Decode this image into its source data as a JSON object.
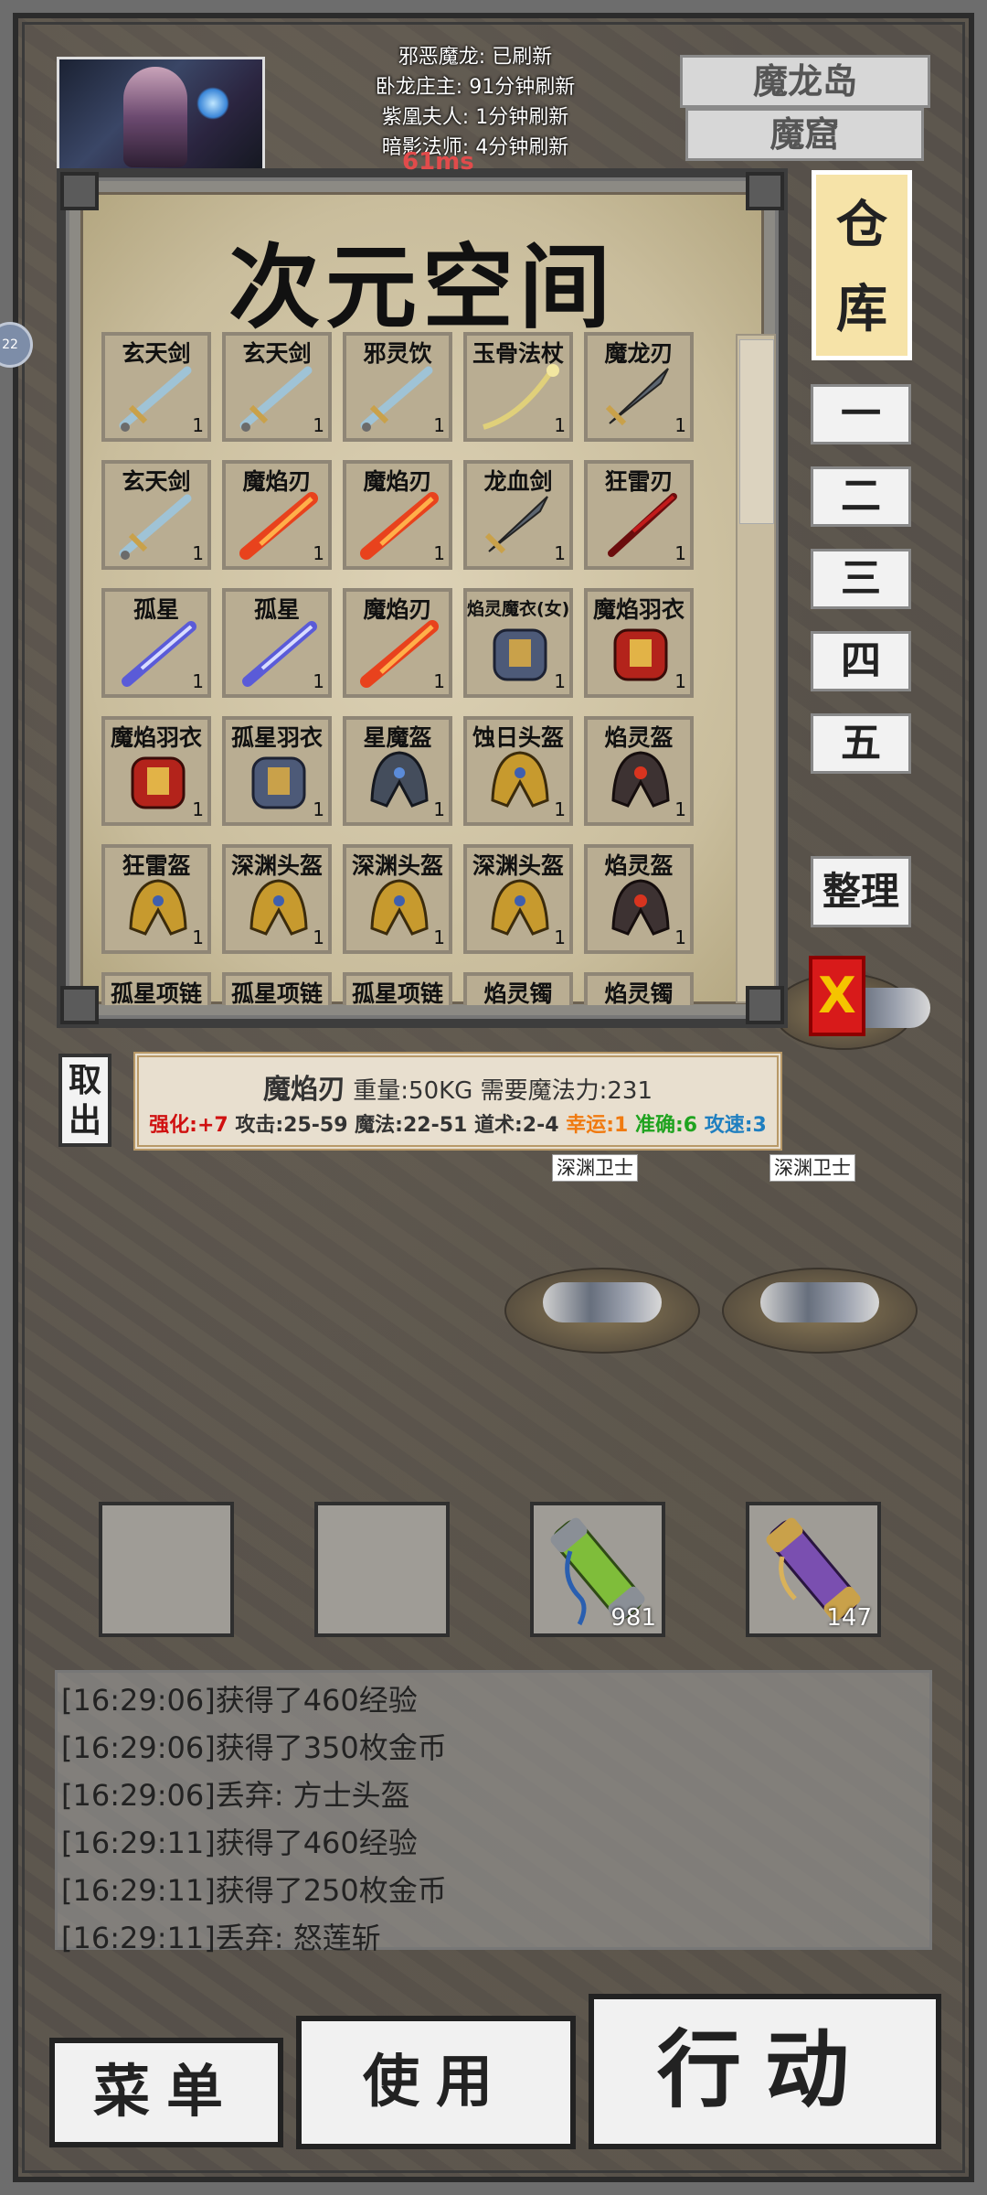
{
  "hud": {
    "boss_lines": [
      "邪恶魔龙: 已刷新",
      "卧龙庄主: 91分钟刷新",
      "紫凰夫人: 1分钟刷新",
      "暗影法师: 4分钟刷新"
    ],
    "ping": "61ms",
    "location_main": "魔龙岛",
    "location_sub": "魔窟",
    "side_indicator": "22"
  },
  "warehouse": {
    "title": "次元空间",
    "tab_label": "仓库",
    "pages": [
      "一",
      "二",
      "三",
      "四",
      "五"
    ],
    "sort_label": "整理",
    "close_label": "X",
    "take_label": "取出",
    "items": [
      {
        "name": "玄天剑",
        "count": "1",
        "kind": "sword"
      },
      {
        "name": "玄天剑",
        "count": "1",
        "kind": "sword"
      },
      {
        "name": "邪灵饮",
        "count": "1",
        "kind": "sword"
      },
      {
        "name": "玉骨法杖",
        "count": "1",
        "kind": "staff"
      },
      {
        "name": "魔龙刃",
        "count": "1",
        "kind": "blade"
      },
      {
        "name": "玄天剑",
        "count": "1",
        "kind": "sword"
      },
      {
        "name": "魔焰刃",
        "count": "1",
        "kind": "fire"
      },
      {
        "name": "魔焰刃",
        "count": "1",
        "kind": "fire"
      },
      {
        "name": "龙血剑",
        "count": "1",
        "kind": "blade"
      },
      {
        "name": "狂雷刃",
        "count": "1",
        "kind": "blood"
      },
      {
        "name": "孤星",
        "count": "1",
        "kind": "star"
      },
      {
        "name": "孤星",
        "count": "1",
        "kind": "star"
      },
      {
        "name": "魔焰刃",
        "count": "1",
        "kind": "fire"
      },
      {
        "name": "焰灵魔衣(女)",
        "count": "1",
        "kind": "armor"
      },
      {
        "name": "魔焰羽衣",
        "count": "1",
        "kind": "armorred"
      },
      {
        "name": "魔焰羽衣",
        "count": "1",
        "kind": "armorred"
      },
      {
        "name": "孤星羽衣",
        "count": "1",
        "kind": "armor"
      },
      {
        "name": "星魔盔",
        "count": "1",
        "kind": "helm"
      },
      {
        "name": "蚀日头盔",
        "count": "1",
        "kind": "helmgold"
      },
      {
        "name": "焰灵盔",
        "count": "1",
        "kind": "helmred"
      },
      {
        "name": "狂雷盔",
        "count": "1",
        "kind": "helmgold"
      },
      {
        "name": "深渊头盔",
        "count": "1",
        "kind": "helmgold"
      },
      {
        "name": "深渊头盔",
        "count": "1",
        "kind": "helmgold"
      },
      {
        "name": "深渊头盔",
        "count": "1",
        "kind": "helmgold"
      },
      {
        "name": "焰灵盔",
        "count": "1",
        "kind": "helmred"
      },
      {
        "name": "孤星项链",
        "count": "",
        "kind": "necklace"
      },
      {
        "name": "孤星项链",
        "count": "",
        "kind": "necklace"
      },
      {
        "name": "孤星项链",
        "count": "",
        "kind": "necklace"
      },
      {
        "name": "焰灵镯",
        "count": "",
        "kind": "bracelet"
      },
      {
        "name": "焰灵镯",
        "count": "",
        "kind": "bracelet"
      }
    ]
  },
  "tooltip": {
    "name": "魔焰刃",
    "weight": "重量:50KG",
    "mana_req": "需要魔法力:231",
    "stats": [
      {
        "text": "强化:+7",
        "color": "#d01010"
      },
      {
        "text": "攻击:25-59",
        "color": "#333333"
      },
      {
        "text": "魔法:22-51",
        "color": "#333333"
      },
      {
        "text": "道术:2-4",
        "color": "#333333"
      },
      {
        "text": "幸运:1",
        "color": "#f07a10"
      },
      {
        "text": "准确:6",
        "color": "#1fa31f"
      },
      {
        "text": "攻速:3",
        "color": "#1f7fc0"
      }
    ]
  },
  "monsters": [
    "深渊卫士",
    "深渊卫士"
  ],
  "quick_slots": [
    {
      "count": "",
      "item": ""
    },
    {
      "count": "",
      "item": ""
    },
    {
      "count": "981",
      "item": "green-scroll"
    },
    {
      "count": "147",
      "item": "purple-scroll"
    }
  ],
  "log": [
    "[16:29:06]获得了460经验",
    "[16:29:06]获得了350枚金币",
    "[16:29:06]丢弃: 方士头盔",
    "[16:29:11]获得了460经验",
    "[16:29:11]获得了250枚金币",
    "[16:29:11]丢弃: 怒莲斩"
  ],
  "buttons": {
    "menu": "菜单",
    "use": "使用",
    "action": "行动"
  }
}
